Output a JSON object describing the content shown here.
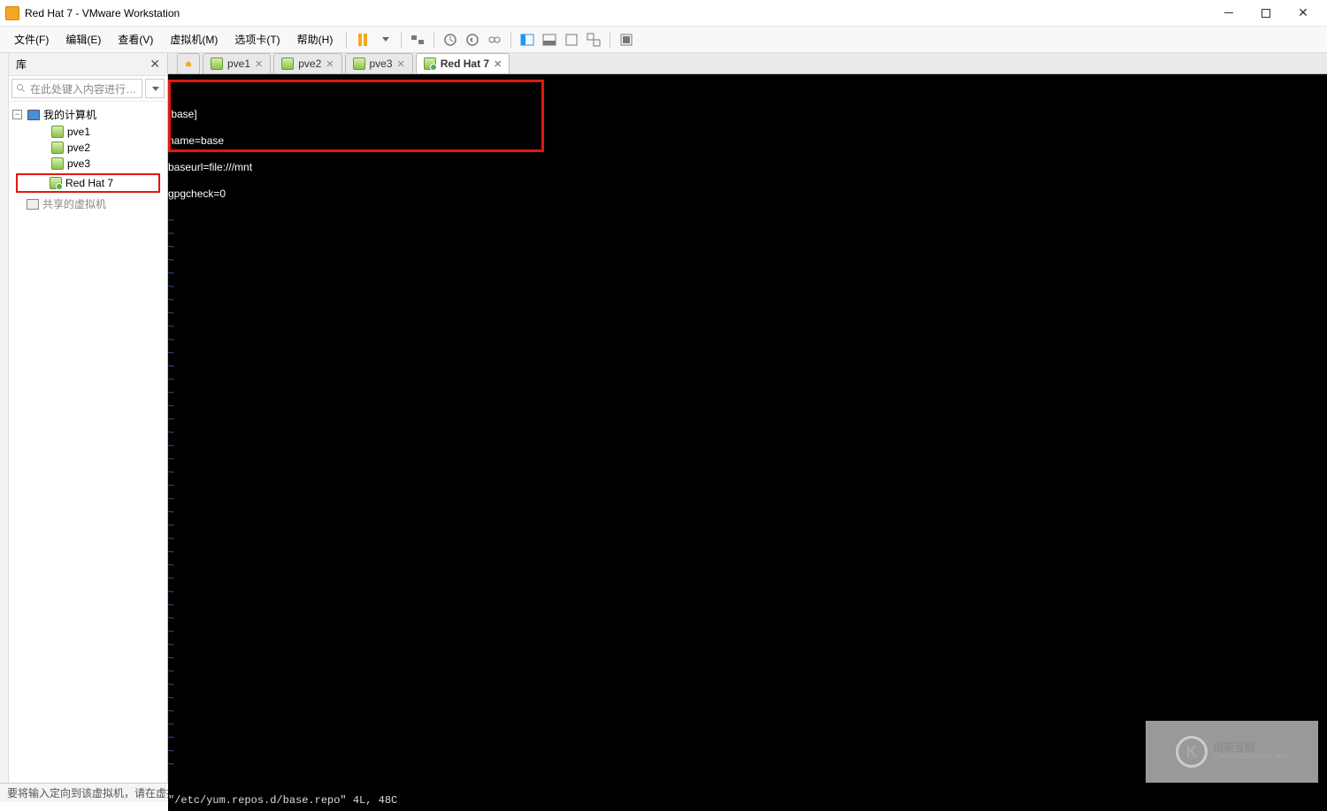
{
  "window": {
    "title": "Red Hat 7 - VMware Workstation"
  },
  "menu": {
    "file": "文件(F)",
    "edit": "编辑(E)",
    "view": "查看(V)",
    "vm": "虚拟机(M)",
    "tabs": "选项卡(T)",
    "help": "帮助(H)"
  },
  "sidebar": {
    "header": "库",
    "search_placeholder": "在此处键入内容进行…",
    "root": "我的计算机",
    "items": [
      "pve1",
      "pve2",
      "pve3",
      "Red Hat 7"
    ],
    "shared": "共享的虚拟机"
  },
  "tabs": [
    {
      "label": "pve1",
      "active": false
    },
    {
      "label": "pve2",
      "active": false
    },
    {
      "label": "pve3",
      "active": false
    },
    {
      "label": "Red Hat 7",
      "active": true
    }
  ],
  "terminal": {
    "lines": [
      "[base]",
      "name=base",
      "baseurl=file:///mnt",
      "gpgcheck=0"
    ],
    "status": "\"/etc/yum.repos.d/base.repo\" 4L, 48C"
  },
  "statusbar": {
    "msg": "要将输入定向到该虚拟机，请在虚拟机内部单击或按 Ctrl+G。"
  },
  "watermark": {
    "brand": "创新互联",
    "sub": "CHUANGXINHULIAN"
  }
}
